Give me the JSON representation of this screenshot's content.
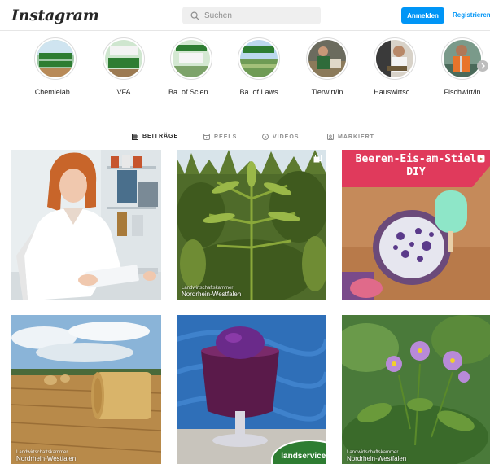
{
  "header": {
    "logo": "Instagram",
    "search_placeholder": "Suchen",
    "login_label": "Anmelden",
    "register_label": "Registrieren"
  },
  "highlights": [
    {
      "label": "Chemielab..."
    },
    {
      "label": "VFA"
    },
    {
      "label": "Ba. of Scien..."
    },
    {
      "label": "Ba. of Laws"
    },
    {
      "label": "Tierwirt/in"
    },
    {
      "label": "Hauswirtsc..."
    },
    {
      "label": "Fischwirt/in"
    }
  ],
  "tabs": [
    {
      "label": "BEITRÄGE",
      "icon": "grid-icon",
      "active": true
    },
    {
      "label": "REELS",
      "icon": "reels-icon",
      "active": false
    },
    {
      "label": "VIDEOS",
      "icon": "video-icon",
      "active": false
    },
    {
      "label": "MARKIERT",
      "icon": "tag-icon",
      "active": false
    }
  ],
  "posts": [
    {
      "subject": "lab-worker"
    },
    {
      "subject": "hemp-field",
      "watermark_small": "Landwirtschaftskammer",
      "watermark_big": "Nordrhein-Westfalen",
      "icon": "multi-post-icon"
    },
    {
      "subject": "berry-ice-pops",
      "title_line1": "Beeren-Eis-am-Stiel",
      "title_line2": "DIY",
      "icon": "reel-icon"
    },
    {
      "subject": "hay-bale-field",
      "watermark_small": "Landwirtschaftskammer",
      "watermark_big": "Nordrhein-Westfalen"
    },
    {
      "subject": "berry-smoothie",
      "badge": "landservice.de"
    },
    {
      "subject": "potato-blossom",
      "watermark_small": "Landwirtschaftskammer",
      "watermark_big": "Nordrhein-Westfalen"
    }
  ],
  "colors": {
    "accent": "#0095f6",
    "title_banner": "#e03a5c"
  }
}
